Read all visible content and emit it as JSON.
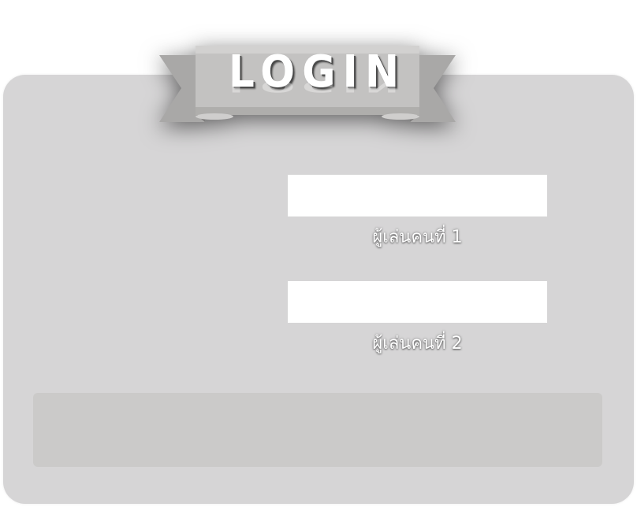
{
  "banner": {
    "title": "LOGIN"
  },
  "form": {
    "player1": {
      "value": "",
      "label": "ผู้เล่นคนที่ 1"
    },
    "player2": {
      "value": "",
      "label": "ผู้เล่นคนที่ 2"
    },
    "submit_label": ""
  },
  "colors": {
    "panel": "#d6d5d6",
    "ribbon": "#bdbcbb",
    "input_bg": "#ffffff",
    "bottom_bar": "#cbcac9"
  },
  "icons": [
    "ribbon-banner"
  ]
}
